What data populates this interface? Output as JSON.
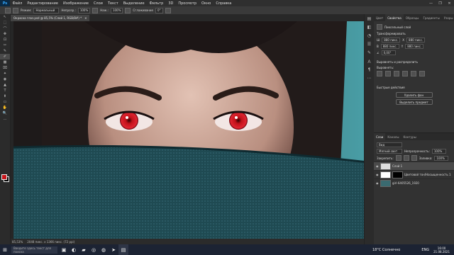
{
  "app": {
    "logo": "Ps"
  },
  "menu": [
    "Файл",
    "Редактирование",
    "Изображение",
    "Слои",
    "Текст",
    "Выделение",
    "Фильтр",
    "3D",
    "Просмотр",
    "Окно",
    "Справка"
  ],
  "window_controls": [
    "—",
    "❐",
    "✕"
  ],
  "options": {
    "mode_label": "Режим:",
    "mode_value": "Нормальный",
    "opacity_label": "Непрозр.:",
    "opacity_value": "100%",
    "flow_label": "Наж.:",
    "flow_value": "100%",
    "smoothing_label": "Сглаживание",
    "angle": "0°"
  },
  "document_tab": {
    "title": "Окраска глаз.psd @ 85,5% (Слой 1, RGB/8#) *",
    "close": "✕"
  },
  "status": {
    "zoom": "85,53%",
    "size": "2048 пикс. x 1366 пикс. (72 ppi)"
  },
  "tools": [
    "↖",
    "⬚",
    "⌒",
    "✥",
    "⊡",
    "✂",
    "✎",
    "✐",
    "▩",
    "⌧",
    "✦",
    "◉",
    "▲",
    "T",
    "⬆",
    "▭",
    "✋",
    "🔍",
    "…"
  ],
  "right_strip": [
    "▤",
    "◧",
    "◔",
    "☰",
    "✎",
    "Ａ",
    "¶",
    "⋯"
  ],
  "properties": {
    "tabs": [
      "Цвет",
      "Свойства",
      "Образцы",
      "Градиенты",
      "Узоры"
    ],
    "layer_type": "Пиксельный слой",
    "transform_header": "Трансформировать",
    "w": "880 пикс.",
    "h": "880 пикс.",
    "x": "880 пикс.",
    "y": "880 пикс.",
    "angle": "0,00°",
    "align_header": "Выровнять и распределить",
    "align_label": "Выровнять:",
    "quick_actions": "Быстрые действия",
    "btn_remove_bg": "Удалить фон",
    "btn_select_subject": "Выделить предмет"
  },
  "layers": {
    "tabs": [
      "Слои",
      "Каналы",
      "Контуры"
    ],
    "filter": "Вид",
    "blend": "Мягкий свет",
    "opacity_label": "Непрозрачность:",
    "opacity": "100%",
    "lock_label": "Закрепить:",
    "fill_label": "Заливка:",
    "fill": "100%",
    "items": [
      {
        "name": "Слой 1",
        "selected": true
      },
      {
        "name": "Цветовой тон/Насыщенность 1",
        "selected": false
      },
      {
        "name": "girl-6405526_1920",
        "selected": false
      }
    ]
  },
  "taskbar": {
    "search": "Введите здесь текст для поиска",
    "weather": "18°C Солнечно",
    "lang": "ENG",
    "time": "16:00",
    "date": "21.08.2021"
  }
}
